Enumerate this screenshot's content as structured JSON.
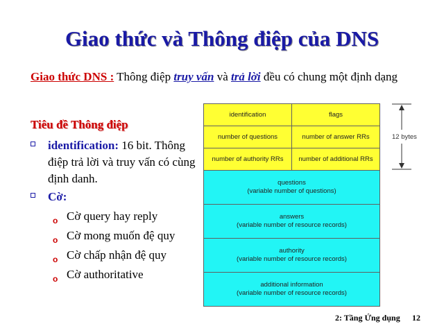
{
  "title": "Giao thức và Thông điệp của DNS",
  "intro": {
    "label": "Giao thức DNS :",
    "part1": " Thông điệp ",
    "query": "truy vấn",
    "part2": " và ",
    "reply": "trả lời",
    "part3": " đều có chung một định dạng"
  },
  "subheading": "Tiêu đề Thông điệp",
  "bullets": [
    {
      "label": "identification:",
      "text": " 16 bit. Thông điệp trả lời và truy vấn có cùng định danh."
    },
    {
      "label": "Cờ:",
      "text": ""
    }
  ],
  "flags": [
    "Cờ query hay reply",
    "Cờ mong muốn đệ quy",
    "Cờ chấp nhận đệ quy",
    "Cờ authoritative"
  ],
  "table": {
    "header_rows": [
      [
        "identification",
        "flags"
      ],
      [
        "number of questions",
        "number of answer RRs"
      ],
      [
        "number of authority RRs",
        "number of additional RRs"
      ]
    ],
    "sections": [
      {
        "name": "questions",
        "desc": "(variable number of questions)"
      },
      {
        "name": "answers",
        "desc": "(variable number of resource records)"
      },
      {
        "name": "authority",
        "desc": "(variable number of resource  records)"
      },
      {
        "name": "additional information",
        "desc": "(variable number of resource records)"
      }
    ],
    "header_size": "12 bytes",
    "colors": {
      "header": "#ffff33",
      "body": "#22f5f5"
    }
  },
  "footer": {
    "chapter": "2: Tầng Ứng dụng",
    "page": "12"
  }
}
